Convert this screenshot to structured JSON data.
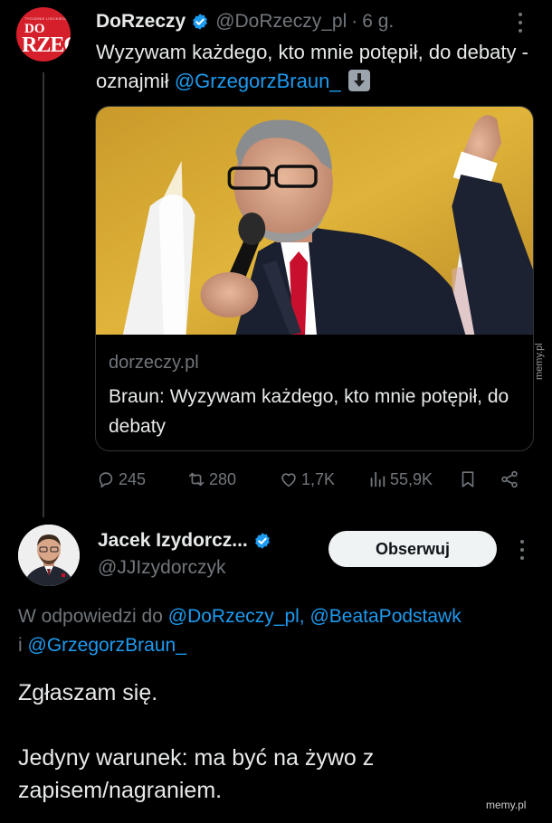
{
  "tweet1": {
    "avatar_small_text": "TYGODNIK LISICKIEGO",
    "avatar_logo_line1": "DO",
    "avatar_logo_line2": "RZECZY",
    "display_name": "DoRzeczy",
    "handle": "@DoRzeczy_pl",
    "separator": "·",
    "time": "6 g.",
    "text": "Wyzywam każdego, kto mnie potępił, do debaty - oznajmił ",
    "text_mention": "@GrzegorzBraun_",
    "link_card": {
      "domain": "dorzeczy.pl",
      "title": "Braun: Wyzywam każdego, kto mnie potępił, do debaty"
    },
    "stats": {
      "replies": "245",
      "reposts": "280",
      "likes": "1,7K",
      "views": "55,9K"
    }
  },
  "tweet2": {
    "display_name": "Jacek Izydorcz...",
    "handle": "@JJIzydorczyk",
    "follow_label": "Obserwuj",
    "reply_prefix": "W odpowiedzi do ",
    "reply_mention_1": "@DoRzeczy_pl,",
    "reply_mention_2": "@BeataPodstawk",
    "reply_and": "i ",
    "reply_mention_3": "@GrzegorzBraun_",
    "body_line1": "Zgłaszam się.",
    "body_line2": "Jedyny warunek: ma być na żywo z zapisem/nagraniem."
  },
  "watermarks": {
    "side": "memy.pl",
    "bottom": "memy.pl"
  },
  "colors": {
    "background": "#000000",
    "text": "#e7e9ea",
    "secondary": "#71767b",
    "link": "#1d9bf0",
    "brand_red": "#d51f2a",
    "follow_bg": "#eff3f4"
  },
  "icons": [
    "verified-badge-icon",
    "more-icon",
    "reply-icon",
    "repost-icon",
    "like-icon",
    "views-icon",
    "bookmark-icon",
    "share-icon",
    "down-arrow-emoji"
  ]
}
